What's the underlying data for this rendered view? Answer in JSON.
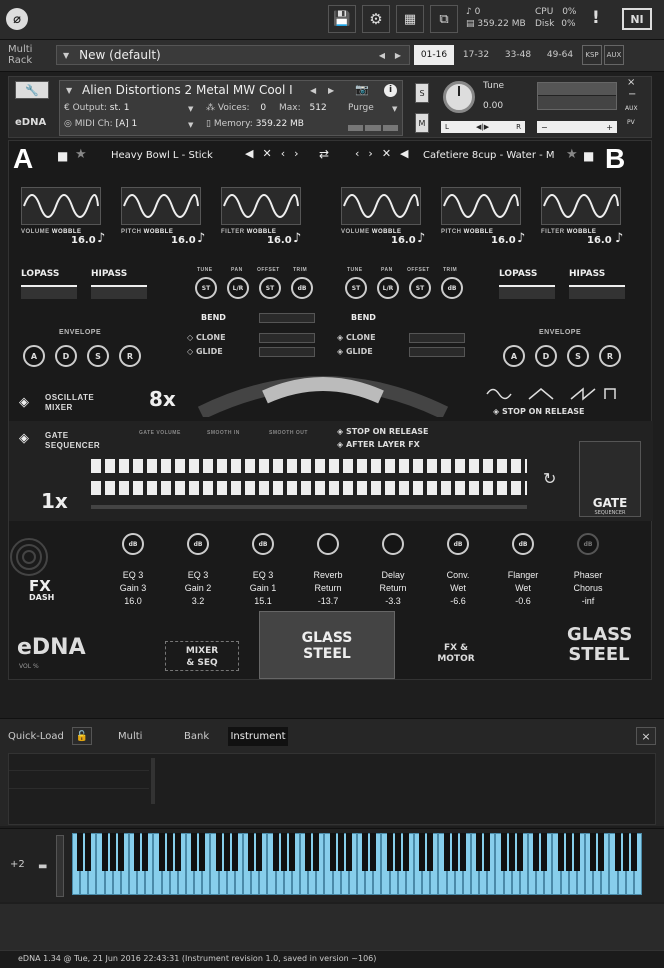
{
  "top": {
    "memory_count": "0",
    "memory_size": "359.22 MB",
    "cpu_label": "CPU",
    "cpu_value": "0%",
    "disk_label": "Disk",
    "disk_value": "0%",
    "warn": "!",
    "ni": "NI"
  },
  "rack": {
    "label1": "Multi",
    "label2": "Rack",
    "preset": "New (default)",
    "pages": [
      "01-16",
      "17-32",
      "33-48",
      "49-64"
    ],
    "ksp": "KSP",
    "aux": "AUX"
  },
  "instrument": {
    "name": "Alien Distortions 2 Metal MW Cool I",
    "output_label": "Output:",
    "output_value": "st. 1",
    "voices_label": "Voices:",
    "voices_value": "0",
    "max_label": "Max:",
    "max_value": "512",
    "purge": "Purge",
    "midi_label": "MIDI Ch:",
    "midi_value": "[A] 1",
    "memory_label": "Memory:",
    "memory_value": "359.22 MB",
    "tune_label": "Tune",
    "tune_value": "0.00",
    "s": "S",
    "m": "M",
    "l": "L",
    "r": "R",
    "aux": "AUX",
    "pv": "PV"
  },
  "edna": {
    "logo": "eDNA",
    "layer_a": "Heavy Bowl L - Stick",
    "layer_b": "Cafetiere 8cup - Water - M",
    "wobble_a": [
      {
        "l1": "VOLUME",
        "l2": "WOBBLE",
        "v": "16.0"
      },
      {
        "l1": "PITCH",
        "l2": "WOBBLE",
        "v": "16.0"
      },
      {
        "l1": "FILTER",
        "l2": "WOBBLE",
        "v": "16.0"
      }
    ],
    "wobble_b": [
      {
        "l1": "VOLUME",
        "l2": "WOBBLE",
        "v": "16.0"
      },
      {
        "l1": "PITCH",
        "l2": "WOBBLE",
        "v": "16.0"
      },
      {
        "l1": "FILTER",
        "l2": "WOBBLE",
        "v": "16.0"
      }
    ],
    "lopass": "LOPASS",
    "hipass": "HIPASS",
    "knob_labels": [
      "TUNE",
      "PAN",
      "OFFSET",
      "TRIM"
    ],
    "knob_text": [
      "ST",
      "L/R",
      "ST",
      "dB"
    ],
    "bend": "BEND",
    "clone": "CLONE",
    "glide": "GLIDE",
    "envelope": "ENVELOPE",
    "adsr": [
      "A",
      "D",
      "S",
      "R"
    ],
    "oscillate": "OSCILLATE",
    "mixer": "MIXER",
    "mult": "8x",
    "stop_on_release": "STOP ON RELEASE",
    "gate": "GATE",
    "sequencer": "SEQUENCER",
    "gate_volume": "GATE VOLUME",
    "smooth_in": "SMOOTH IN",
    "smooth_out": "SMOOTH OUT",
    "stop_on_release2": "STOP ON RELEASE",
    "after_layer_fx": "AFTER LAYER FX",
    "gate_mult": "1x",
    "fx_dash1": "FX",
    "fx_dash2": "DASH",
    "fx": [
      {
        "l1": "EQ 3",
        "l2": "Gain 3",
        "v": "16.0"
      },
      {
        "l1": "EQ 3",
        "l2": "Gain 2",
        "v": "3.2"
      },
      {
        "l1": "EQ 3",
        "l2": "Gain 1",
        "v": "15.1"
      },
      {
        "l1": "Reverb",
        "l2": "Return",
        "v": "-13.7"
      },
      {
        "l1": "Delay",
        "l2": "Return",
        "v": "-3.3"
      },
      {
        "l1": "Conv.",
        "l2": "Wet",
        "v": "-6.6"
      },
      {
        "l1": "Flanger",
        "l2": "Wet",
        "v": "-0.6"
      },
      {
        "l1": "Phaser",
        "l2": "Chorus",
        "v": "-inf"
      }
    ],
    "bottom_logo": "eDNA",
    "vol": "VOL %",
    "mixer_seq1": "MIXER",
    "mixer_seq2": "& SEQ",
    "glass1": "GLASS",
    "glass2": "STEEL",
    "fx_motor1": "FX &",
    "fx_motor2": "MOTOR"
  },
  "quickload": {
    "title": "Quick-Load",
    "tabs": [
      "Multi",
      "Bank",
      "Instrument"
    ],
    "close": "×"
  },
  "keyboard": {
    "octave": "+2"
  },
  "status": "eDNA 1.34 @ Tue, 21 Jun 2016 22:43:31 (Instrument revision 1.0, saved in version ~106)"
}
